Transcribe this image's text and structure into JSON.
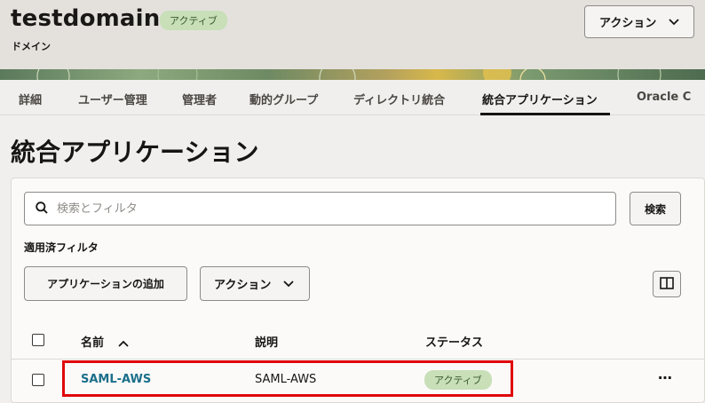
{
  "header": {
    "title": "testdomain",
    "status_badge": "アクティブ",
    "subtitle": "ドメイン",
    "action_button": "アクション"
  },
  "tabs": [
    {
      "label": "詳細",
      "active": false
    },
    {
      "label": "ユーザー管理",
      "active": false
    },
    {
      "label": "管理者",
      "active": false
    },
    {
      "label": "動的グループ",
      "active": false
    },
    {
      "label": "ディレクトリ統合",
      "active": false
    },
    {
      "label": "統合アプリケーション",
      "active": true
    },
    {
      "label": "Oracle C",
      "active": false
    }
  ],
  "page_title": "統合アプリケーション",
  "search": {
    "placeholder": "検索とフィルタ",
    "button": "検索"
  },
  "filter_label": "適用済フィルタ",
  "toolbar": {
    "add_button": "アプリケーションの追加",
    "action_button": "アクション"
  },
  "table": {
    "columns": [
      "名前",
      "説明",
      "ステータス"
    ],
    "rows": [
      {
        "name": "SAML-AWS",
        "description": "SAML-AWS",
        "status": "アクティブ"
      }
    ]
  },
  "colors": {
    "accent_link": "#1c6f8a",
    "badge_bg": "#c8dfb8",
    "highlight": "#e0060a"
  }
}
